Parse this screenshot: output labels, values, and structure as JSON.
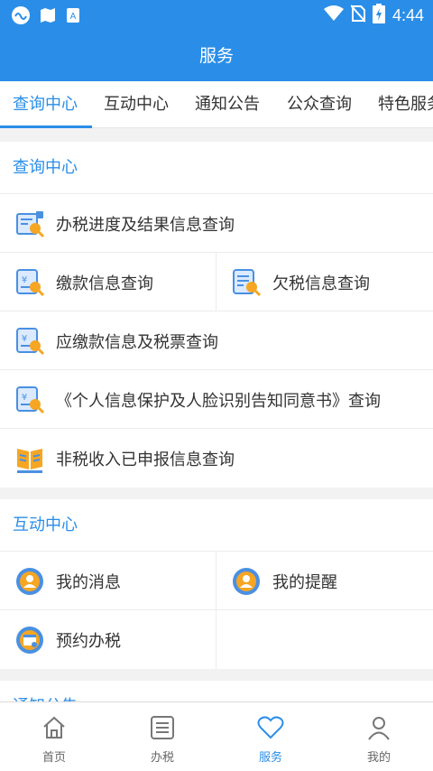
{
  "status_bar": {
    "time": "4:44"
  },
  "header": {
    "title": "服务"
  },
  "tabs": [
    {
      "label": "查询中心",
      "active": true
    },
    {
      "label": "互动中心"
    },
    {
      "label": "通知公告"
    },
    {
      "label": "公众查询"
    },
    {
      "label": "特色服务"
    }
  ],
  "query_center": {
    "title": "查询中心",
    "items": [
      {
        "label": "办税进度及结果信息查询",
        "icon": "progress-query-icon"
      },
      {
        "label": "缴款信息查询",
        "icon": "payment-query-icon"
      },
      {
        "label": "欠税信息查询",
        "icon": "arrears-query-icon"
      },
      {
        "label": "应缴款信息及税票查询",
        "icon": "payable-query-icon"
      },
      {
        "label": "《个人信息保护及人脸识别告知同意书》查询",
        "icon": "consent-query-icon"
      },
      {
        "label": "非税收入已申报信息查询",
        "icon": "book-icon"
      }
    ]
  },
  "interaction_center": {
    "title": "互动中心",
    "items": [
      {
        "label": "我的消息",
        "icon": "user-circle-icon"
      },
      {
        "label": "我的提醒",
        "icon": "user-circle-icon"
      },
      {
        "label": "预约办税",
        "icon": "calendar-circle-icon"
      }
    ]
  },
  "notice_peek": {
    "title": "通知公告"
  },
  "bottom_nav": [
    {
      "label": "首页",
      "icon": "home-icon"
    },
    {
      "label": "办税",
      "icon": "list-icon"
    },
    {
      "label": "服务",
      "icon": "heart-icon",
      "active": true
    },
    {
      "label": "我的",
      "icon": "person-icon"
    }
  ],
  "colors": {
    "primary": "#2a8ee8",
    "icon_orange": "#f6a623"
  }
}
